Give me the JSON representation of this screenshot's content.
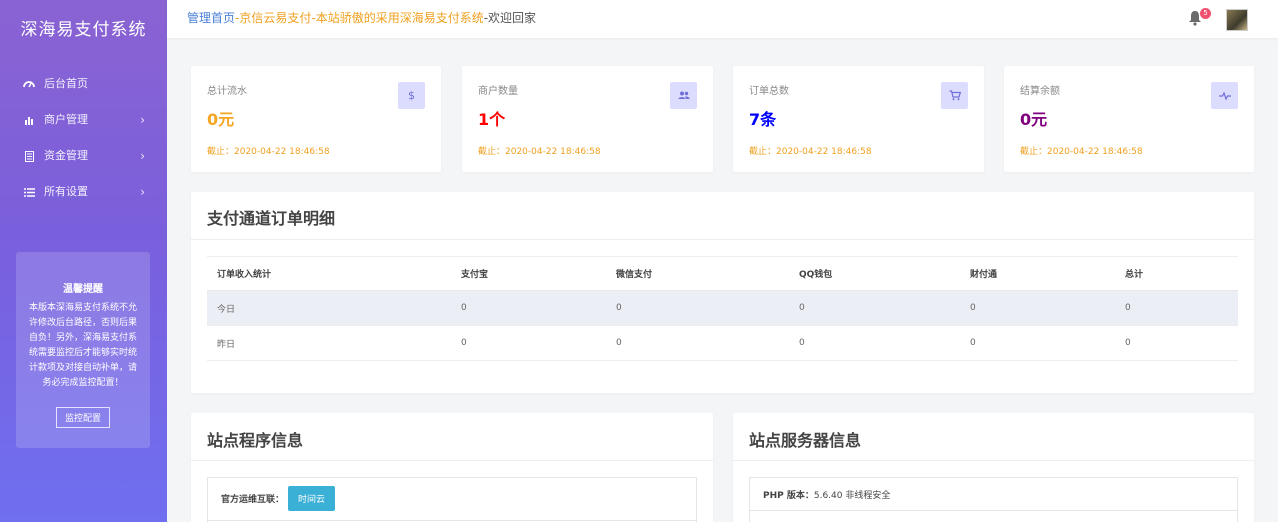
{
  "sidebar": {
    "brand": "深海易支付系统",
    "items": [
      {
        "label": "后台首页",
        "icon": "dashboard-icon"
      },
      {
        "label": "商户管理",
        "icon": "bar-chart-icon"
      },
      {
        "label": "资金管理",
        "icon": "document-icon"
      },
      {
        "label": "所有设置",
        "icon": "list-icon"
      }
    ],
    "chevron": "›",
    "tip": {
      "title": "温馨提醒",
      "text": "本版本深海易支付系统不允许修改后台路径，否则后果自负！另外，深海易支付系统需要监控后才能够实时统计款项及对接自动补单，请务必完成监控配置！",
      "button": "监控配置"
    }
  },
  "topbar": {
    "crumb_home": "管理首页",
    "crumb_sep1": "-",
    "crumb_mid": "京信云易支付-本站骄傲的采用深海易支付系统",
    "crumb_sep2": "-",
    "crumb_end": "欢迎回家",
    "notification_count": "5"
  },
  "stats": [
    {
      "label": "总计流水",
      "value": "0元",
      "date": "截止：2020-04-22 18:46:58",
      "icon": "dollar-icon",
      "color": "#f5a623"
    },
    {
      "label": "商户数量",
      "value": "1个",
      "date": "截止：2020-04-22 18:46:58",
      "icon": "users-icon",
      "color": "#ff0000"
    },
    {
      "label": "订单总数",
      "value": "7条",
      "date": "截止：2020-04-22 18:46:58",
      "icon": "cart-icon",
      "color": "#0000ff"
    },
    {
      "label": "结算余额",
      "value": "0元",
      "date": "截止：2020-04-22 18:46:58",
      "icon": "pulse-icon",
      "color": "#800080"
    }
  ],
  "orders": {
    "title": "支付通道订单明细",
    "headers": [
      "订单收入统计",
      "支付宝",
      "微信支付",
      "QQ钱包",
      "财付通",
      "总计"
    ],
    "rows": [
      [
        "今日",
        "0",
        "0",
        "0",
        "0",
        "0"
      ],
      [
        "昨日",
        "0",
        "0",
        "0",
        "0",
        "0"
      ]
    ]
  },
  "program": {
    "title": "站点程序信息",
    "ops_label": "官方运维互联：",
    "ops_button": "时间云"
  },
  "server": {
    "title": "站点服务器信息",
    "php_label": "PHP 版本：",
    "php_value": "5.6.40 非线程安全"
  }
}
